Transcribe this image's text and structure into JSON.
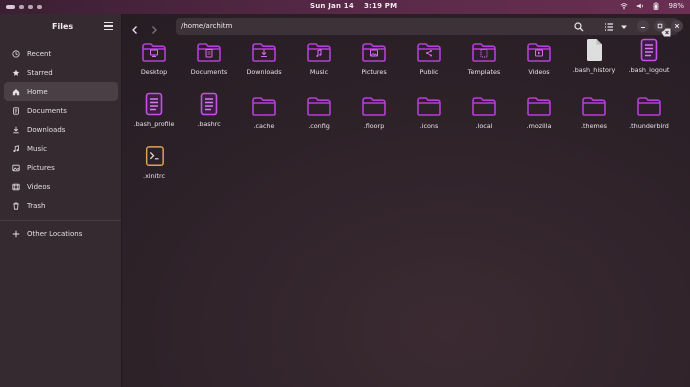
{
  "topbar": {
    "date": "Sun Jan 14",
    "time": "3:19 PM",
    "battery": "98%"
  },
  "sidebar": {
    "title": "Files",
    "items": [
      {
        "label": "Recent",
        "icon": "clock-icon"
      },
      {
        "label": "Starred",
        "icon": "star-icon"
      },
      {
        "label": "Home",
        "icon": "home-icon",
        "active": true
      },
      {
        "label": "Documents",
        "icon": "document-icon"
      },
      {
        "label": "Downloads",
        "icon": "download-icon"
      },
      {
        "label": "Music",
        "icon": "music-icon"
      },
      {
        "label": "Pictures",
        "icon": "picture-icon"
      },
      {
        "label": "Videos",
        "icon": "video-icon"
      },
      {
        "label": "Trash",
        "icon": "trash-icon"
      }
    ],
    "other_locations": "Other Locations"
  },
  "header": {
    "path": "/home/architm"
  },
  "files": [
    {
      "name": "Desktop",
      "type": "folder",
      "glyph": "desktop"
    },
    {
      "name": "Documents",
      "type": "folder",
      "glyph": "docs"
    },
    {
      "name": "Downloads",
      "type": "folder",
      "glyph": "download"
    },
    {
      "name": "Music",
      "type": "folder",
      "glyph": "music"
    },
    {
      "name": "Pictures",
      "type": "folder",
      "glyph": "picture"
    },
    {
      "name": "Public",
      "type": "folder",
      "glyph": "share"
    },
    {
      "name": "Templates",
      "type": "folder",
      "glyph": "template"
    },
    {
      "name": "Videos",
      "type": "folder",
      "glyph": "video"
    },
    {
      "name": ".bash_history",
      "type": "file-plain"
    },
    {
      "name": ".bash_logout",
      "type": "file-text"
    },
    {
      "name": ".bash_profile",
      "type": "file-text"
    },
    {
      "name": ".bashrc",
      "type": "file-text"
    },
    {
      "name": ".cache",
      "type": "folder"
    },
    {
      "name": ".config",
      "type": "folder"
    },
    {
      "name": ".floorp",
      "type": "folder"
    },
    {
      "name": ".icons",
      "type": "folder"
    },
    {
      "name": ".local",
      "type": "folder"
    },
    {
      "name": ".mozilla",
      "type": "folder"
    },
    {
      "name": ".themes",
      "type": "folder"
    },
    {
      "name": ".thunderbird",
      "type": "folder"
    },
    {
      "name": ".xinitrc",
      "type": "file-script"
    }
  ],
  "colors": {
    "accent": "#b43fd6",
    "accent_light": "#d76cf0",
    "sidebar_bg": "#342a30",
    "content_bg": "#2b2027"
  }
}
